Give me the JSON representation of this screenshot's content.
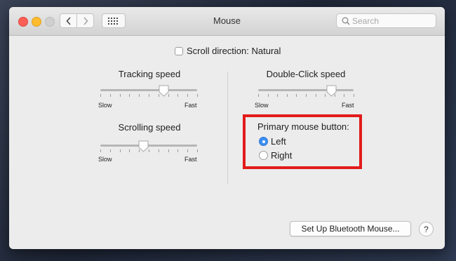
{
  "window": {
    "title": "Mouse"
  },
  "toolbar": {
    "search_placeholder": "Search"
  },
  "scroll_direction": {
    "label": "Scroll direction: Natural",
    "checked": false
  },
  "tracking_speed": {
    "label": "Tracking speed",
    "min_label": "Slow",
    "max_label": "Fast",
    "value_fraction": 0.65
  },
  "scrolling_speed": {
    "label": "Scrolling speed",
    "min_label": "Slow",
    "max_label": "Fast",
    "value_fraction": 0.44
  },
  "double_click_speed": {
    "label": "Double-Click speed",
    "min_label": "Slow",
    "max_label": "Fast",
    "value_fraction": 0.77
  },
  "primary_button": {
    "label": "Primary mouse button:",
    "options": [
      {
        "label": "Left",
        "selected": true
      },
      {
        "label": "Right",
        "selected": false
      }
    ]
  },
  "footer": {
    "setup_button": "Set Up Bluetooth Mouse...",
    "help_button": "?"
  },
  "colors": {
    "highlight": "#e21b1b",
    "accent": "#3b8ff5"
  }
}
